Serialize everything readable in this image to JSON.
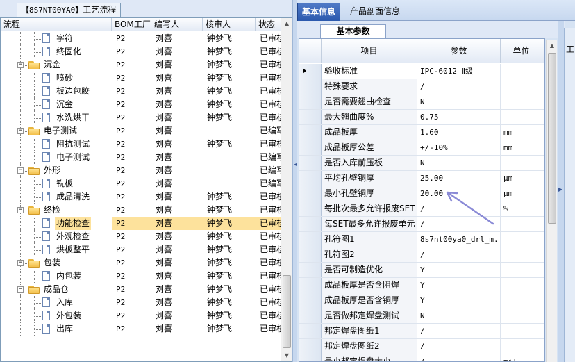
{
  "left": {
    "title_code": "【8S7NT00YA0】",
    "title_text": "工艺流程",
    "columns": [
      "流程",
      "BOM工厂",
      "编写人",
      "核审人",
      "状态"
    ],
    "rows": [
      {
        "level": 2,
        "kind": "doc",
        "label": "字符",
        "bom": "P2",
        "writer": "刘喜",
        "reviewer": "钟梦飞",
        "status": "已审核"
      },
      {
        "level": 2,
        "kind": "doc",
        "label": "终固化",
        "bom": "P2",
        "writer": "刘喜",
        "reviewer": "钟梦飞",
        "status": "已审核"
      },
      {
        "level": 1,
        "kind": "folder",
        "label": "沉金",
        "bom": "P2",
        "writer": "刘喜",
        "reviewer": "钟梦飞",
        "status": "已审核"
      },
      {
        "level": 2,
        "kind": "doc",
        "label": "喷砂",
        "bom": "P2",
        "writer": "刘喜",
        "reviewer": "钟梦飞",
        "status": "已审核"
      },
      {
        "level": 2,
        "kind": "doc",
        "label": "板边包胶",
        "bom": "P2",
        "writer": "刘喜",
        "reviewer": "钟梦飞",
        "status": "已审核"
      },
      {
        "level": 2,
        "kind": "doc",
        "label": "沉金",
        "bom": "P2",
        "writer": "刘喜",
        "reviewer": "钟梦飞",
        "status": "已审核"
      },
      {
        "level": 2,
        "kind": "doc",
        "label": "水洗烘干",
        "bom": "P2",
        "writer": "刘喜",
        "reviewer": "钟梦飞",
        "status": "已审核"
      },
      {
        "level": 1,
        "kind": "folder",
        "label": "电子测试",
        "bom": "P2",
        "writer": "刘喜",
        "reviewer": "",
        "status": "已编写"
      },
      {
        "level": 2,
        "kind": "doc",
        "label": "阻抗测试",
        "bom": "P2",
        "writer": "刘喜",
        "reviewer": "钟梦飞",
        "status": "已审核"
      },
      {
        "level": 2,
        "kind": "doc",
        "label": "电子测试",
        "bom": "P2",
        "writer": "刘喜",
        "reviewer": "",
        "status": "已编写"
      },
      {
        "level": 1,
        "kind": "folder",
        "label": "外形",
        "bom": "P2",
        "writer": "刘喜",
        "reviewer": "",
        "status": "已编写"
      },
      {
        "level": 2,
        "kind": "doc",
        "label": "铣板",
        "bom": "P2",
        "writer": "刘喜",
        "reviewer": "",
        "status": "已编写"
      },
      {
        "level": 2,
        "kind": "doc",
        "label": "成品清洗",
        "bom": "P2",
        "writer": "刘喜",
        "reviewer": "钟梦飞",
        "status": "已审核"
      },
      {
        "level": 1,
        "kind": "folder",
        "label": "终检",
        "bom": "P2",
        "writer": "刘喜",
        "reviewer": "钟梦飞",
        "status": "已审核"
      },
      {
        "level": 2,
        "kind": "doc",
        "label": "功能检查",
        "bom": "P2",
        "writer": "刘喜",
        "reviewer": "钟梦飞",
        "status": "已审核",
        "selected": true
      },
      {
        "level": 2,
        "kind": "doc",
        "label": "外观检查",
        "bom": "P2",
        "writer": "刘喜",
        "reviewer": "钟梦飞",
        "status": "已审核"
      },
      {
        "level": 2,
        "kind": "doc",
        "label": "烘板整平",
        "bom": "P2",
        "writer": "刘喜",
        "reviewer": "钟梦飞",
        "status": "已审核"
      },
      {
        "level": 1,
        "kind": "folder",
        "label": "包装",
        "bom": "P2",
        "writer": "刘喜",
        "reviewer": "钟梦飞",
        "status": "已审核"
      },
      {
        "level": 2,
        "kind": "doc",
        "label": "内包装",
        "bom": "P2",
        "writer": "刘喜",
        "reviewer": "钟梦飞",
        "status": "已审核"
      },
      {
        "level": 1,
        "kind": "folder",
        "label": "成品仓",
        "bom": "P2",
        "writer": "刘喜",
        "reviewer": "钟梦飞",
        "status": "已审核"
      },
      {
        "level": 2,
        "kind": "doc",
        "label": "入库",
        "bom": "P2",
        "writer": "刘喜",
        "reviewer": "钟梦飞",
        "status": "已审核"
      },
      {
        "level": 2,
        "kind": "doc",
        "label": "外包装",
        "bom": "P2",
        "writer": "刘喜",
        "reviewer": "钟梦飞",
        "status": "已审核"
      },
      {
        "level": 2,
        "kind": "doc",
        "label": "出库",
        "bom": "P2",
        "writer": "刘喜",
        "reviewer": "钟梦飞",
        "status": "已审核"
      }
    ]
  },
  "right": {
    "tabs": [
      "基本信息",
      "产品剖面信息"
    ],
    "subtab": "基本参数",
    "side_label": "工",
    "columns": [
      "项目",
      "参数",
      "单位"
    ],
    "rows": [
      {
        "name": "验收标准",
        "value": "IPC-6012 Ⅱ级",
        "unit": "",
        "y": "Y",
        "current": true
      },
      {
        "name": "特殊要求",
        "value": "/",
        "unit": "",
        "y": "Y"
      },
      {
        "name": "是否需要翘曲检查",
        "value": "N",
        "unit": "",
        "y": "Y"
      },
      {
        "name": "最大翘曲度%",
        "value": "0.75",
        "unit": "",
        "y": "Y"
      },
      {
        "name": "成品板厚",
        "value": "1.60",
        "unit": "mm",
        "y": "Y"
      },
      {
        "name": "成品板厚公差",
        "value": "+/-10%",
        "unit": "mm",
        "y": "Y"
      },
      {
        "name": "是否入库前压板",
        "value": "N",
        "unit": "",
        "y": "Y"
      },
      {
        "name": "平均孔壁铜厚",
        "value": "25.00",
        "unit": "μm",
        "y": "Y"
      },
      {
        "name": "最小孔壁铜厚",
        "value": "20.00",
        "unit": "μm",
        "y": "Y"
      },
      {
        "name": "每批次最多允许报废SET",
        "value": "/",
        "unit": "%",
        "y": "Y"
      },
      {
        "name": "每SET最多允许报废单元",
        "value": "/",
        "unit": "",
        "y": "Y"
      },
      {
        "name": "孔符图1",
        "value": "8s7nt00ya0_drl_m...",
        "unit": "",
        "y": "Y"
      },
      {
        "name": "孔符图2",
        "value": "/",
        "unit": "",
        "y": "Y"
      },
      {
        "name": "是否可制造优化",
        "value": "Y",
        "unit": "",
        "y": "Y"
      },
      {
        "name": "成品板厚是否含阻焊",
        "value": "Y",
        "unit": "",
        "y": "Y"
      },
      {
        "name": "成品板厚是否含铜厚",
        "value": "Y",
        "unit": "",
        "y": "Y"
      },
      {
        "name": "是否做邦定焊盘测试",
        "value": "N",
        "unit": "",
        "y": "Y"
      },
      {
        "name": "邦定焊盘图纸1",
        "value": "/",
        "unit": "",
        "y": "Y"
      },
      {
        "name": "邦定焊盘图纸2",
        "value": "/",
        "unit": "",
        "y": "Y"
      },
      {
        "name": "最小邦定焊盘大小",
        "value": "/",
        "unit": "mil",
        "y": "Y"
      }
    ]
  }
}
